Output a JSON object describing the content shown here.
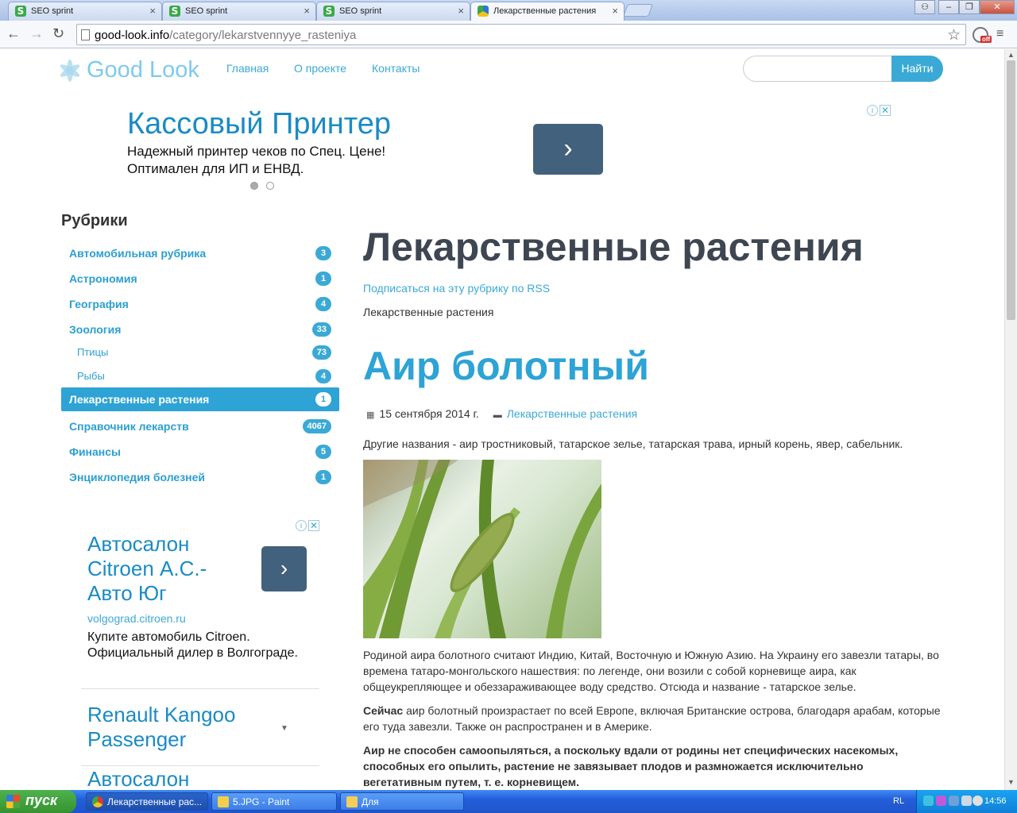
{
  "browser": {
    "tabs": [
      {
        "title": "SEO sprint",
        "active": false
      },
      {
        "title": "SEO sprint",
        "active": false
      },
      {
        "title": "SEO sprint",
        "active": false
      },
      {
        "title": "Лекарственные растения",
        "active": true
      }
    ],
    "close_glyph": "×",
    "window_buttons": {
      "user": "⚇",
      "minimize": "–",
      "restore": "❐",
      "close": "✕"
    },
    "nav": {
      "back": "←",
      "forward": "→",
      "reload": "↻"
    },
    "url_host": "good-look.info",
    "url_path": "/category/lekarstvennyye_rasteniya",
    "star_glyph": "☆",
    "ext_badge": "off",
    "menu_glyph": "≡"
  },
  "site": {
    "logo_text": "Good Look",
    "nav": [
      "Главная",
      "О проекте",
      "Контакты"
    ],
    "search": {
      "placeholder": "",
      "button": "Найти"
    }
  },
  "ad_top": {
    "title": "Кассовый Принтер",
    "line1": "Надежный принтер чеков по Спец. Цене!",
    "line2": "Оптимален для ИП и ЕНВД.",
    "arrow": "›",
    "adchoices": {
      "info": "i",
      "close": "✕"
    }
  },
  "sidebar": {
    "heading": "Рубрики",
    "categories": [
      {
        "name": "Автомобильная рубрика",
        "count": "3",
        "sub": false,
        "active": false
      },
      {
        "name": "Астрономия",
        "count": "1",
        "sub": false,
        "active": false
      },
      {
        "name": "География",
        "count": "4",
        "sub": false,
        "active": false
      },
      {
        "name": "Зоология",
        "count": "33",
        "sub": false,
        "active": false
      },
      {
        "name": "Птицы",
        "count": "73",
        "sub": true,
        "active": false
      },
      {
        "name": "Рыбы",
        "count": "4",
        "sub": true,
        "active": false
      },
      {
        "name": "Лекарственные растения",
        "count": "1",
        "sub": false,
        "active": true
      },
      {
        "name": "Справочник лекарств",
        "count": "4067",
        "sub": false,
        "active": false
      },
      {
        "name": "Финансы",
        "count": "5",
        "sub": false,
        "active": false
      },
      {
        "name": "Энциклопедия болезней",
        "count": "1",
        "sub": false,
        "active": false
      }
    ]
  },
  "ad_side": {
    "title": "Автосалон Citroen А.С.- Авто Юг",
    "arrow": "›",
    "url": "volgograd.citroen.ru",
    "desc": "Купите автомобиль Citroen. Официальный дилер в Волгограде.",
    "second_title": "Renault Kangoo Passenger",
    "caret": "▼",
    "third_title": "Автосалон"
  },
  "main": {
    "category_title": "Лекарственные растения",
    "rss_link": "Подписаться на эту рубрику по RSS",
    "category_desc": "Лекарственные растения",
    "post": {
      "title": "Аир болотный",
      "date_icon": "▦",
      "date": "15 сентября 2014 г.",
      "folder_icon": "▬",
      "category": "Лекарственные растения",
      "alt_names": "Другие названия - аир тростниковый, татарское зелье, татарская трава, ирный корень, явер, сабельник.",
      "p1": "Родиной аира болотного считают Индию, Китай, Восточную и Южную Азию. На Украину его завезли татары, во времена татаро-монгольского нашествия: по легенде, они возили с собой корневище аира, как общеукрепляющее и обеззараживающее воду средство. Отсюда и название - татарское зелье.",
      "p2_bold": "Сейчас",
      "p2": " аир болотный произрастает по всей Европе, включая Британские острова, благодаря арабам, которые его туда завезли. Также он распространен и в Америке.",
      "p3": "Аир не способен самоопыляться, а поскольку вдали от родины нет специфических насекомых, способных его опылить, растение не завязывает плодов и размножается исключительно вегетативным путем, т. е. корневищем."
    }
  },
  "taskbar": {
    "start": "пуск",
    "tasks": [
      "Лекарственные рас...",
      "5.JPG - Paint",
      "Для"
    ],
    "lang": "RL",
    "clock": "14:56"
  },
  "colors": {
    "accent": "#3ba9d6",
    "heading": "#3e4651",
    "ad_button": "#42617c"
  }
}
